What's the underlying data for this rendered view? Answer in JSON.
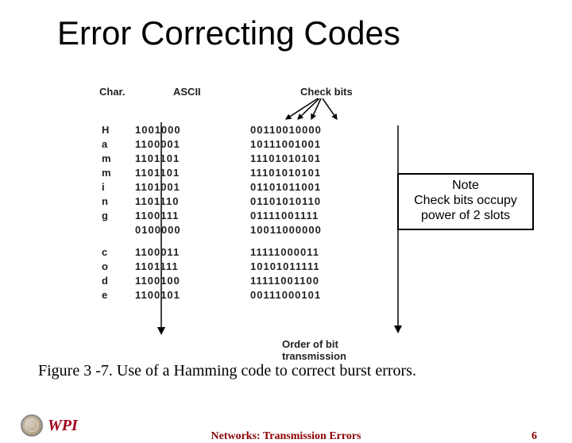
{
  "title": "Error Correcting Codes",
  "headers": {
    "char": "Char.",
    "ascii": "ASCII",
    "check": "Check bits"
  },
  "rows": [
    {
      "char": "H",
      "ascii": "1001000",
      "check": "00110010000"
    },
    {
      "char": "a",
      "ascii": "1100001",
      "check": "10111001001"
    },
    {
      "char": "m",
      "ascii": "1101101",
      "check": "11101010101"
    },
    {
      "char": "m",
      "ascii": "1101101",
      "check": "11101010101"
    },
    {
      "char": "i",
      "ascii": "1101001",
      "check": "01101011001"
    },
    {
      "char": "n",
      "ascii": "1101110",
      "check": "01101010110"
    },
    {
      "char": "g",
      "ascii": "1100111",
      "check": "01111001111"
    },
    {
      "char": "",
      "ascii": "0100000",
      "check": "10011000000"
    },
    {
      "char": "c",
      "ascii": "1100011",
      "check": "11111000011"
    },
    {
      "char": "o",
      "ascii": "1101111",
      "check": "10101011111"
    },
    {
      "char": "d",
      "ascii": "1100100",
      "check": "11111001100"
    },
    {
      "char": "e",
      "ascii": "1100101",
      "check": "00111000101"
    }
  ],
  "order_label": "Order of bit transmission",
  "note": {
    "title": "Note",
    "line1": "Check bits occupy",
    "line2": "power of 2 slots"
  },
  "caption": "Figure 3 -7. Use of a Hamming code to correct burst errors.",
  "footer": {
    "title": "Networks: Transmission Errors",
    "page": "6"
  },
  "logo": {
    "text": "WPI"
  }
}
